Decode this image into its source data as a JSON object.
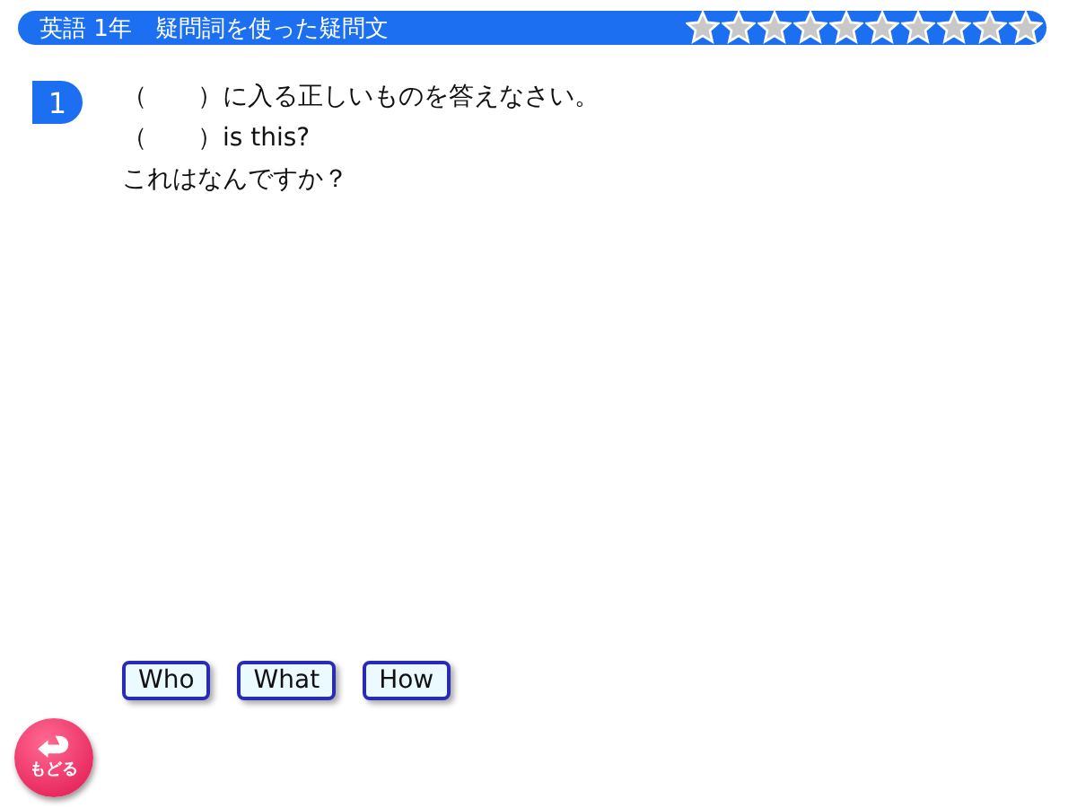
{
  "header": {
    "title": "英語 1年　疑問詞を使った疑問文",
    "star_marks": [
      {
        "filled": false
      },
      {
        "filled": false
      },
      {
        "filled": false
      },
      {
        "filled": false
      },
      {
        "filled": false
      },
      {
        "filled": false
      },
      {
        "filled": false
      },
      {
        "filled": false
      },
      {
        "filled": false
      },
      {
        "filled": false
      }
    ]
  },
  "question": {
    "number": "1",
    "lines": [
      "（　　）に入る正しいものを答えなさい。",
      "（　　）is this?",
      "これはなんですか？"
    ]
  },
  "choices": [
    "Who",
    "What",
    "How"
  ],
  "back_button": {
    "label": "もどる"
  }
}
